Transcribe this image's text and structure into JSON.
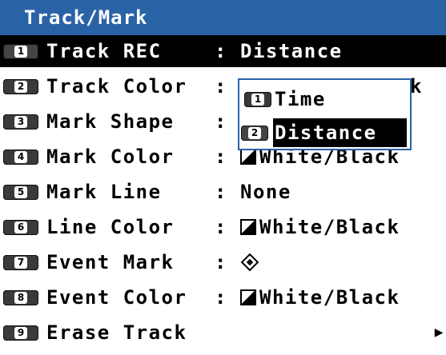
{
  "title": "Track/Mark",
  "menu": [
    {
      "key": "1",
      "label": "Track REC",
      "colon": ":",
      "value": "Distance",
      "selected": true
    },
    {
      "key": "2",
      "label": "Track Color",
      "colon": ":",
      "value": "k"
    },
    {
      "key": "3",
      "label": "Mark Shape",
      "colon": ":",
      "value": ""
    },
    {
      "key": "4",
      "label": "Mark Color",
      "colon": ":",
      "value": "White/Black",
      "swatch": true
    },
    {
      "key": "5",
      "label": "Mark Line",
      "colon": ":",
      "value": "None"
    },
    {
      "key": "6",
      "label": "Line Color",
      "colon": ":",
      "value": "White/Black",
      "swatch": true
    },
    {
      "key": "7",
      "label": "Event Mark",
      "colon": ":",
      "value": "",
      "icon": "diamond-icon"
    },
    {
      "key": "8",
      "label": "Event Color",
      "colon": ":",
      "value": "White/Black",
      "swatch": true
    },
    {
      "key": "9",
      "label": "Erase Track",
      "colon": "",
      "value": "",
      "icon": "arrow-right-icon"
    }
  ],
  "popup": {
    "options": [
      {
        "key": "1",
        "label": "Time"
      },
      {
        "key": "2",
        "label": "Distance",
        "selected": true
      }
    ]
  },
  "colors": {
    "title_bar": "#2a62a6",
    "popup_border": "#2a62a6",
    "selection": "#000000",
    "text": "#000000"
  }
}
